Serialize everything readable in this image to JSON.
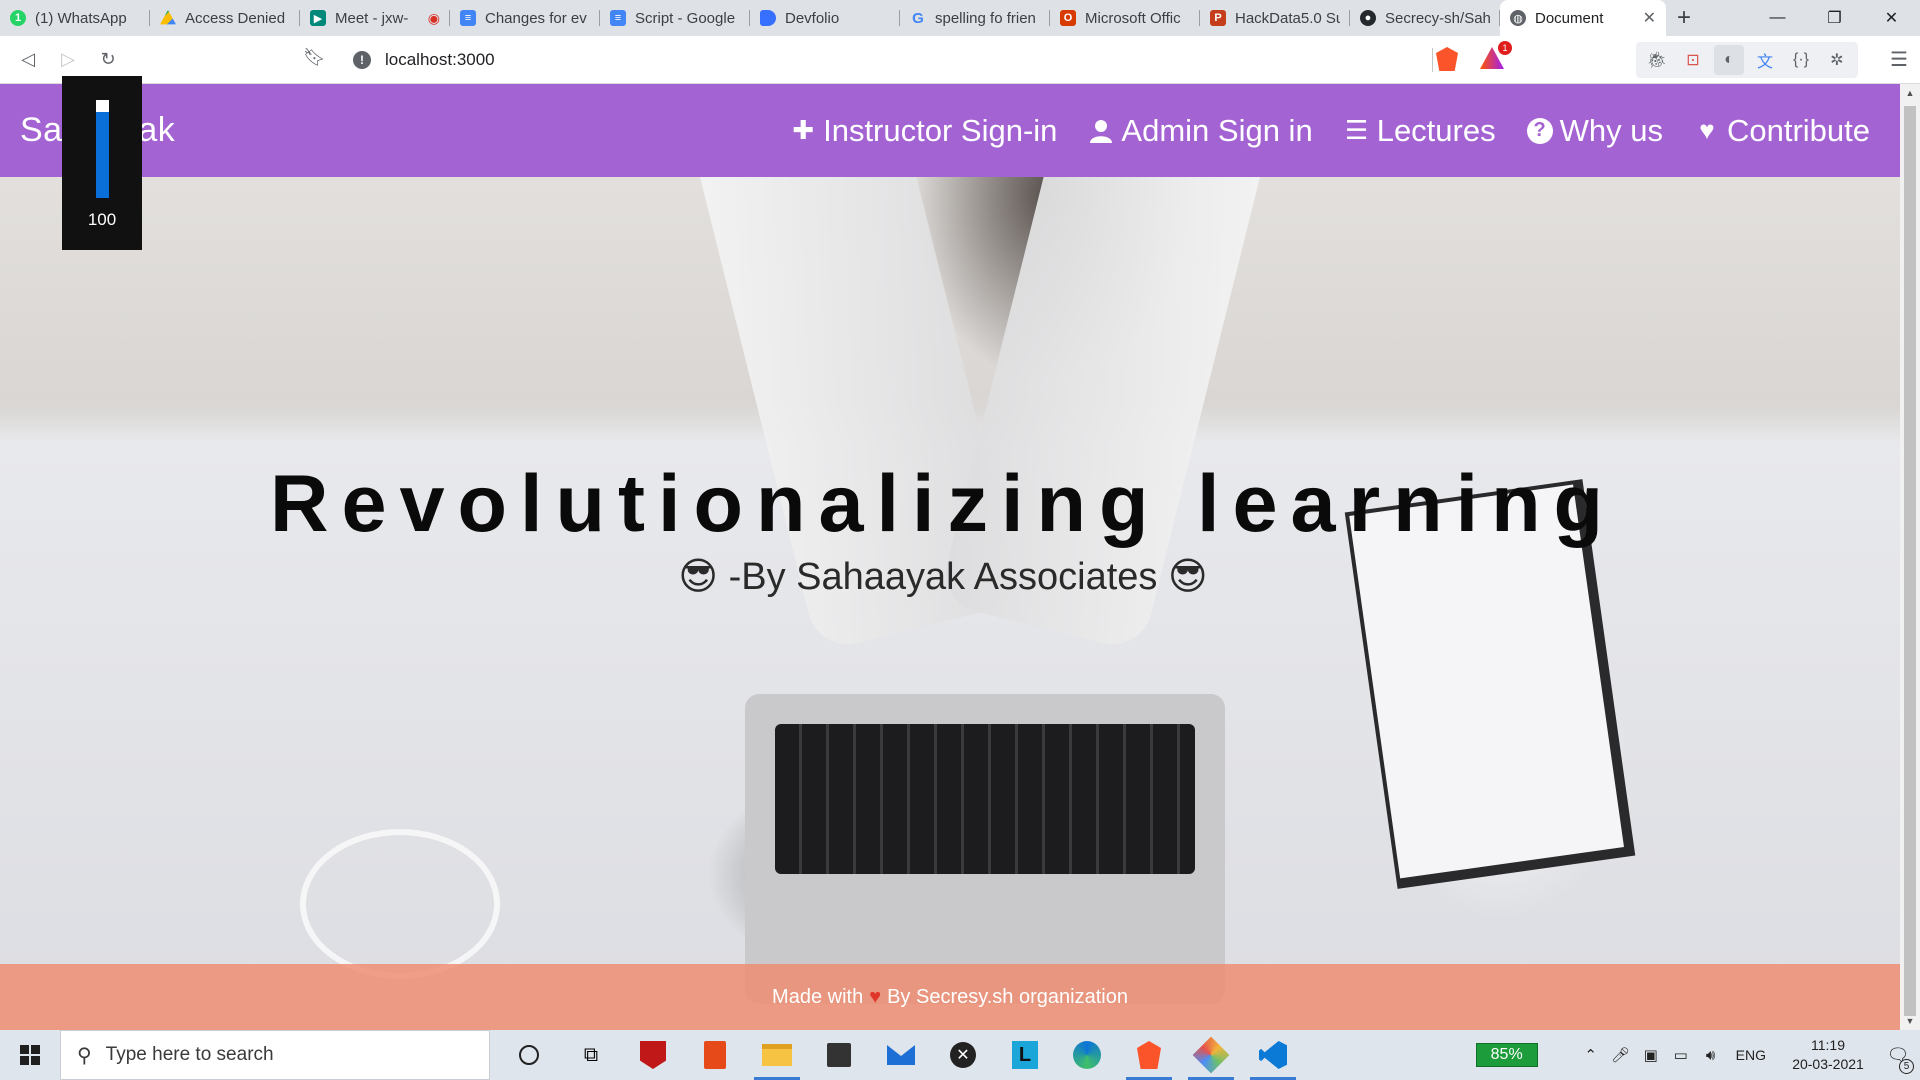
{
  "browser": {
    "tabs": [
      {
        "title": "(1) WhatsApp",
        "icon": "whatsapp-icon",
        "color": "#25d366"
      },
      {
        "title": "Access Denied",
        "icon": "google-drive-icon",
        "color": "#f4b400"
      },
      {
        "title": "Meet - jxw-",
        "icon": "google-meet-icon",
        "color": "#00897b"
      },
      {
        "title": "Changes for ev",
        "icon": "google-docs-icon",
        "color": "#4285f4"
      },
      {
        "title": "Script - Google",
        "icon": "google-docs-icon",
        "color": "#4285f4"
      },
      {
        "title": "Devfolio",
        "icon": "devfolio-icon",
        "color": "#3770ff"
      },
      {
        "title": "spelling fo frien",
        "icon": "google-icon",
        "color": "#4285f4"
      },
      {
        "title": "Microsoft Offic",
        "icon": "office-icon",
        "color": "#d83b01"
      },
      {
        "title": "HackData5.0 Su",
        "icon": "powerpoint-icon",
        "color": "#c43e1c"
      },
      {
        "title": "Secrecy-sh/Sah",
        "icon": "github-icon",
        "color": "#24292e"
      }
    ],
    "active_tab": {
      "title": "Document",
      "icon": "globe-icon"
    },
    "url": "localhost:3000",
    "shields_badge": "1"
  },
  "site": {
    "brand": "Sahaayak",
    "nav": [
      {
        "label": "Instructor Sign-in",
        "icon": "plus-icon",
        "glyph": "✚"
      },
      {
        "label": "Admin Sign in",
        "icon": "user-icon",
        "glyph": "👤"
      },
      {
        "label": "Lectures",
        "icon": "list-icon",
        "glyph": "☰"
      },
      {
        "label": "Why us",
        "icon": "question-circle-icon",
        "glyph": "?"
      },
      {
        "label": "Contribute",
        "icon": "heart-icon",
        "glyph": "♥"
      }
    ],
    "headline": "Revolutionalizing learning",
    "subline": {
      "emoji": "😎",
      "text": "-By Sahaayak Associates"
    },
    "footer": {
      "prefix": "Made with",
      "suffix": "By Secresy.sh organization"
    },
    "colors": {
      "navbar": "#a463d2",
      "footer": "#ef8b6e"
    }
  },
  "overlay_meter": {
    "value": "100",
    "level": 0.88
  },
  "taskbar": {
    "search_placeholder": "Type here to search",
    "apps": [
      "cortana-icon",
      "task-view-icon",
      "mcafee-icon",
      "office-icon",
      "file-explorer-icon",
      "store-icon",
      "mail-icon",
      "xbox-icon",
      "l-app-icon",
      "edge-icon",
      "brave-icon",
      "gitkraken-icon",
      "vscode-icon"
    ],
    "battery": "85%",
    "language": "ENG",
    "time": "11:19",
    "date": "20-03-2021",
    "notifications": "5"
  }
}
